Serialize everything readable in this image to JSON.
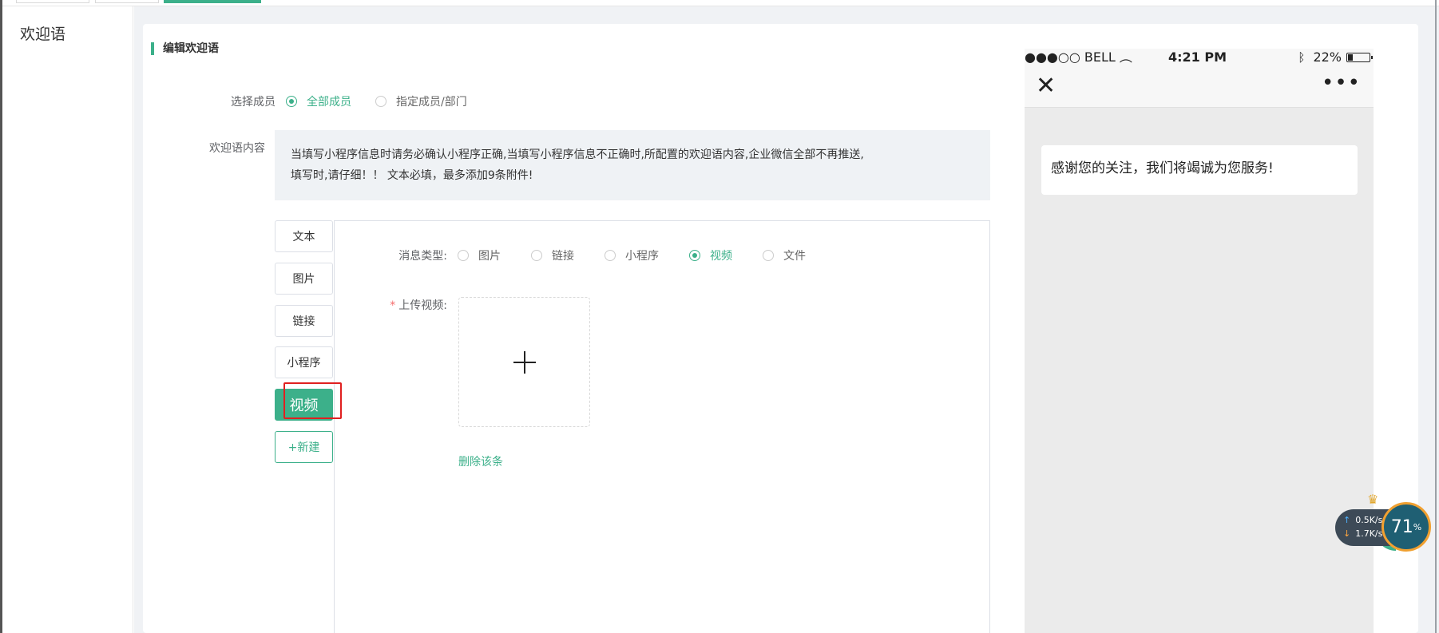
{
  "sidebar": {
    "title": "欢迎语"
  },
  "section": {
    "title": "编辑欢迎语"
  },
  "members": {
    "label": "选择成员",
    "options": [
      {
        "label": "全部成员",
        "checked": true
      },
      {
        "label": "指定成员/部门",
        "checked": false
      }
    ]
  },
  "content": {
    "label": "欢迎语内容",
    "notice_line1": "当填写小程序信息时请务必确认小程序正确,当填写小程序信息不正确时,所配置的欢迎语内容,企业微信全部不再推送,",
    "notice_line2": "填写时,请仔细！！ 文本必填，最多添加9条附件!"
  },
  "type_tabs": [
    "文本",
    "图片",
    "链接",
    "小程序",
    "视频",
    "+新建"
  ],
  "active_tab": "视频",
  "message_type": {
    "label": "消息类型:",
    "options": [
      {
        "label": "图片",
        "checked": false
      },
      {
        "label": "链接",
        "checked": false
      },
      {
        "label": "小程序",
        "checked": false
      },
      {
        "label": "视频",
        "checked": true
      },
      {
        "label": "文件",
        "checked": false
      }
    ]
  },
  "upload": {
    "label": "上传视频:",
    "required": "*"
  },
  "delete_label": "删除该条",
  "phone": {
    "carrier": "●●●○○ BELL",
    "time": "4:21 PM",
    "battery": "22%",
    "message": "感谢您的关注，我们将竭诚为您服务!"
  },
  "net_widget": {
    "up": "0.5K/s",
    "down": "1.7K/s",
    "percent": "71",
    "percent_unit": "%"
  },
  "colors": {
    "accent": "#3cb08a",
    "highlight": "#e02020",
    "gray_bg": "#f0f2f5"
  }
}
